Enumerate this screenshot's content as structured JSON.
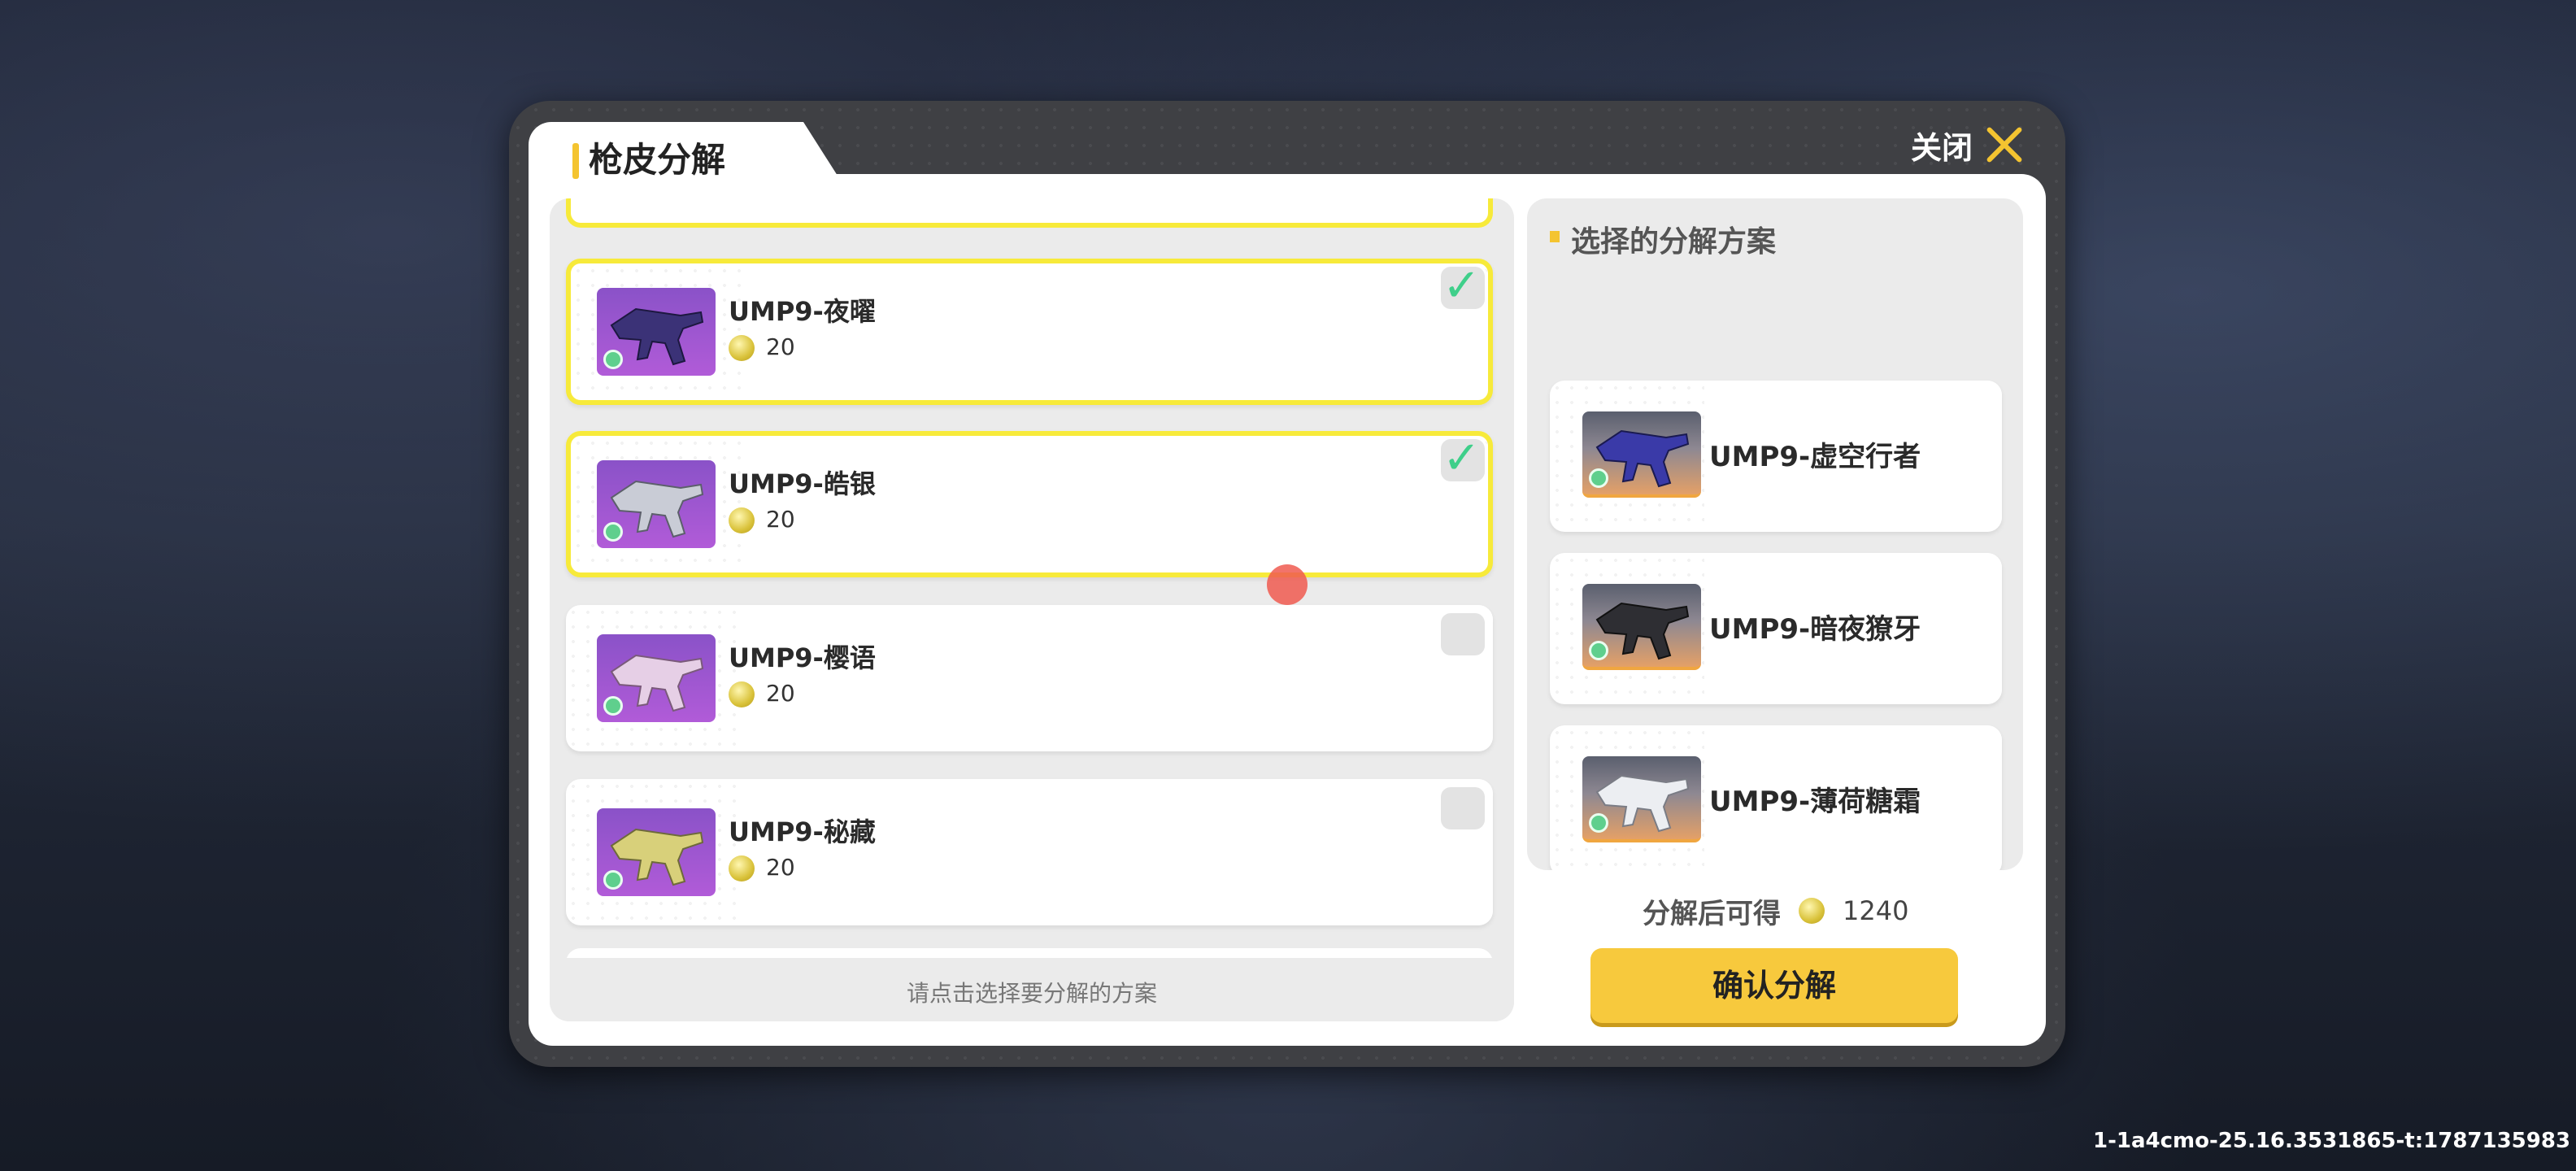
{
  "panel": {
    "title": "枪皮分解",
    "close_label": "关闭"
  },
  "left_list": {
    "items": [
      {
        "name": "UMP9-夜曜",
        "value": "20",
        "selected": true,
        "gun_color": "#3b3277"
      },
      {
        "name": "UMP9-皓银",
        "value": "20",
        "selected": true,
        "gun_color": "#c9ccd6"
      },
      {
        "name": "UMP9-樱语",
        "value": "20",
        "selected": false,
        "gun_color": "#e6cfe6"
      },
      {
        "name": "UMP9-秘藏",
        "value": "20",
        "selected": false,
        "gun_color": "#d8d07a"
      }
    ],
    "hint": "请点击选择要分解的方案"
  },
  "right_panel": {
    "title": "选择的分解方案",
    "items": [
      {
        "name": "UMP9-虚空行者",
        "gun_color": "#3a3aa8"
      },
      {
        "name": "UMP9-暗夜獠牙",
        "gun_color": "#2e2e33"
      },
      {
        "name": "UMP9-薄荷糖霜",
        "gun_color": "#eceef2"
      }
    ]
  },
  "yield": {
    "label": "分解后可得",
    "value": "1240"
  },
  "confirm_label": "确认分解",
  "build_id": "1-1a4cmo-25.16.3531865-t:1787135983",
  "colors": {
    "accent": "#f4c430",
    "selected_border": "#f7ea3a",
    "check": "#3fcf8a"
  }
}
